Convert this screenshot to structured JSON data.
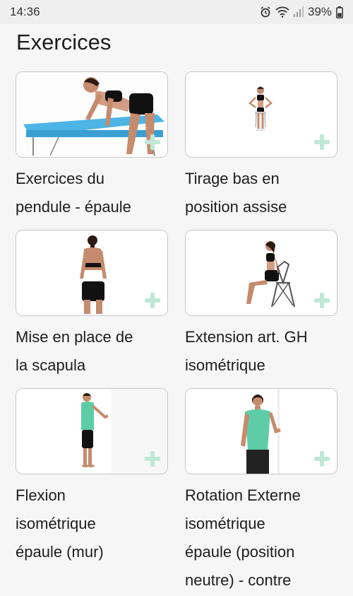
{
  "status_bar": {
    "time": "14:36",
    "battery": "39%",
    "icons": [
      "alarm-icon",
      "wifi-icon",
      "signal-icon",
      "battery-icon"
    ]
  },
  "page": {
    "title": "Exercices"
  },
  "exercises": [
    {
      "title_line1": "Exercices du",
      "title_line2": "pendule - épaule",
      "thumbnail": "woman-leaning-on-table"
    },
    {
      "title_line1": "Tirage bas en",
      "title_line2": "position assise",
      "thumbnail": "woman-seated-on-chair"
    },
    {
      "title_line1": "Mise en place de",
      "title_line2": "la scapula",
      "thumbnail": "woman-back-view"
    },
    {
      "title_line1": "Extension art. GH",
      "title_line2": "isométrique",
      "thumbnail": "woman-seated-side-view"
    },
    {
      "title_line1": "Flexion",
      "title_line2": "isométrique",
      "title_line3": "épaule (mur)",
      "thumbnail": "woman-against-wall"
    },
    {
      "title_line1": "Rotation Externe",
      "title_line2": "isométrique",
      "title_line3": "épaule (position",
      "title_line4": "neutre) - contre",
      "thumbnail": "woman-standing-front"
    }
  ],
  "colors": {
    "accent_plus": "#bfe8d6",
    "card_border": "#c7c7c7",
    "background": "#f5f6f5"
  }
}
